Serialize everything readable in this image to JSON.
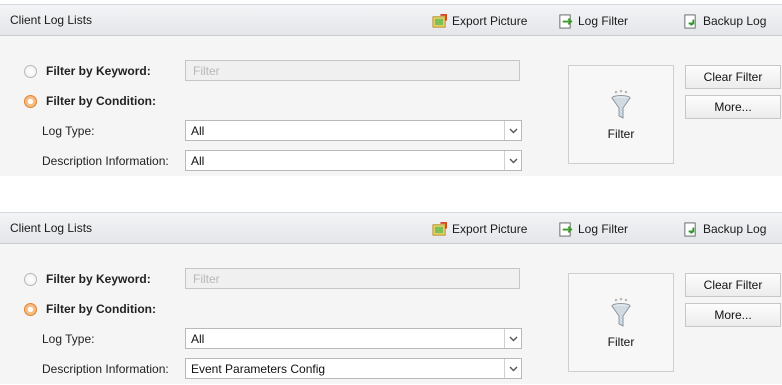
{
  "panels": [
    {
      "title": "Client Log Lists",
      "toolbar": {
        "export_label": "Export Picture",
        "log_filter_label": "Log Filter",
        "backup_label": "Backup Log"
      },
      "keyword": {
        "label": "Filter by Keyword:",
        "placeholder": "Filter",
        "selected": false
      },
      "condition": {
        "label": "Filter by Condition:",
        "selected": true
      },
      "log_type": {
        "label": "Log Type:",
        "value": "All"
      },
      "description": {
        "label": "Description Information:",
        "value": "All"
      },
      "filter_button_label": "Filter",
      "clear_filter_label": "Clear Filter",
      "more_label": "More..."
    },
    {
      "title": "Client Log Lists",
      "toolbar": {
        "export_label": "Export Picture",
        "log_filter_label": "Log Filter",
        "backup_label": "Backup Log"
      },
      "keyword": {
        "label": "Filter by Keyword:",
        "placeholder": "Filter",
        "selected": false
      },
      "condition": {
        "label": "Filter by Condition:",
        "selected": true
      },
      "log_type": {
        "label": "Log Type:",
        "value": "All"
      },
      "description": {
        "label": "Description Information:",
        "value": "Event Parameters Config"
      },
      "filter_button_label": "Filter",
      "clear_filter_label": "Clear Filter",
      "more_label": "More..."
    }
  ],
  "colors": {
    "radio_selected": "#f6b06d",
    "titlebar": "#e4e6ea",
    "panel_body": "#f5f5f5"
  },
  "icons": {
    "export": "picture-export-icon",
    "log_filter": "log-filter-icon",
    "backup": "backup-log-icon",
    "filter": "funnel-icon",
    "dropdown": "chevron-down-icon"
  }
}
